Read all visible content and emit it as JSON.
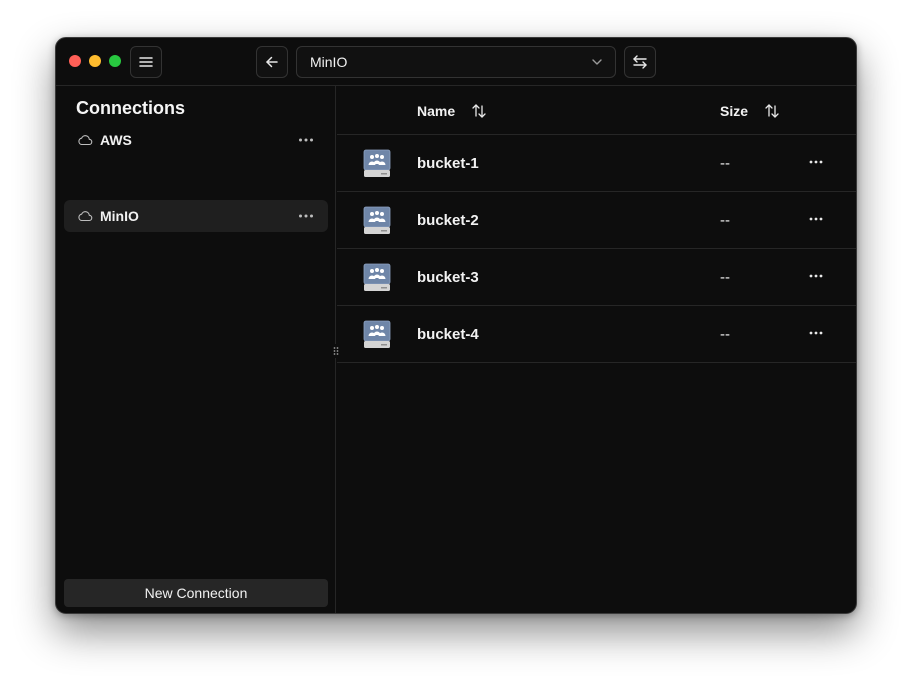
{
  "toolbar": {
    "selected_connection": "MinIO"
  },
  "sidebar": {
    "title": "Connections",
    "items": [
      {
        "label": "AWS",
        "active": false
      },
      {
        "label": "MinIO",
        "active": true
      }
    ],
    "new_connection_label": "New Connection"
  },
  "table": {
    "columns": {
      "name": "Name",
      "size": "Size"
    },
    "rows": [
      {
        "name": "bucket-1",
        "size": "--"
      },
      {
        "name": "bucket-2",
        "size": "--"
      },
      {
        "name": "bucket-3",
        "size": "--"
      },
      {
        "name": "bucket-4",
        "size": "--"
      }
    ]
  },
  "icons": {
    "menu": "hamburger-menu-icon",
    "back": "arrow-left-icon",
    "swap": "swap-arrows-icon",
    "dropdown": "chevron-down-icon",
    "connection": "cloud-icon",
    "more": "more-horizontal-icon",
    "sort": "sort-arrows-icon",
    "bucket": "network-drive-icon",
    "resize": "drag-handle-icon"
  },
  "colors": {
    "window_bg": "#0d0d0d",
    "active_item_bg": "#1f1f1f",
    "button_bg": "#262626",
    "close": "#ff5f57",
    "minimize": "#febc2e",
    "maximize": "#28c840"
  }
}
